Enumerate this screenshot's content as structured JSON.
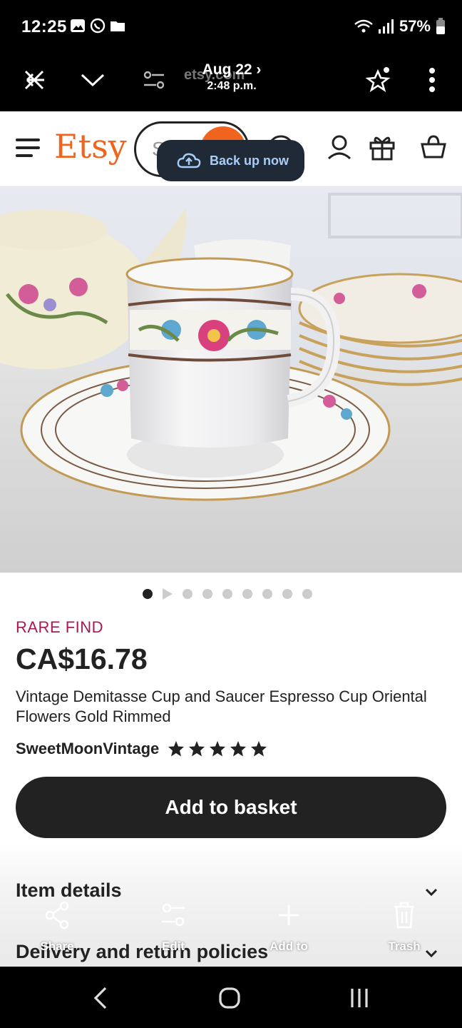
{
  "status_bar": {
    "time": "12:25",
    "battery": "57%",
    "icons": [
      "gallery-icon",
      "whatsapp-icon",
      "folder-icon",
      "wifi-icon",
      "signal-icon",
      "battery-icon"
    ]
  },
  "gallery_toolbar": {
    "date": "Aug 22",
    "time": "2:48 p.m.",
    "url_hint": "etsy.com"
  },
  "etsy_header": {
    "logo": "Etsy",
    "search_placeholder": "S"
  },
  "backup_toast": {
    "label": "Back up now"
  },
  "carousel": {
    "count": 9,
    "active_index": 0
  },
  "product": {
    "badge": "RARE FIND",
    "price": "CA$16.78",
    "title": "Vintage Demitasse Cup and Saucer Espresso Cup Oriental Flowers Gold Rimmed",
    "seller": "SweetMoonVintage",
    "rating": 5,
    "add_button": "Add to basket",
    "sections": [
      "Item details",
      "Delivery and return policies"
    ]
  },
  "gallery_actions": [
    {
      "label": "Share",
      "icon": "share-icon"
    },
    {
      "label": "Edit",
      "icon": "edit-icon"
    },
    {
      "label": "Add to",
      "icon": "plus-icon"
    },
    {
      "label": "Trash",
      "icon": "trash-icon"
    }
  ],
  "colors": {
    "etsy_orange": "#f1641e",
    "rare_find": "#a61a54",
    "button_dark": "#222222",
    "toast_bg": "#1f2a36",
    "toast_text": "#a8cdf7"
  }
}
